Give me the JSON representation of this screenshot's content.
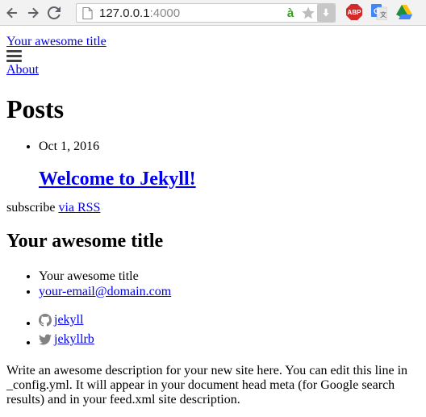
{
  "browser": {
    "url_host": "127.0.0.1",
    "url_port": ":4000",
    "icons": [
      "back-arrow-icon",
      "forward-arrow-icon",
      "reload-icon",
      "page-icon",
      "translate-a-icon",
      "star-icon",
      "download-icon",
      "adblock-plus-icon",
      "google-translate-icon",
      "google-drive-icon"
    ],
    "abp_label": "ABP"
  },
  "header": {
    "site_title": "Your awesome title",
    "nav": [
      {
        "label": "About"
      }
    ]
  },
  "main": {
    "heading": "Posts",
    "posts": [
      {
        "date": "Oct 1, 2016",
        "title": "Welcome to Jekyll!"
      }
    ],
    "subscribe_text": "subscribe ",
    "rss_link": "via RSS"
  },
  "footer": {
    "heading": "Your awesome title",
    "contact": {
      "name": "Your awesome title",
      "email": "your-email@domain.com"
    },
    "social": [
      {
        "icon": "github-icon",
        "label": "jekyll"
      },
      {
        "icon": "twitter-icon",
        "label": "jekyllrb"
      }
    ],
    "description": "Write an awesome description for your new site here. You can edit this line in _config.yml. It will appear in your document head meta (for Google search results) and in your feed.xml site description."
  }
}
